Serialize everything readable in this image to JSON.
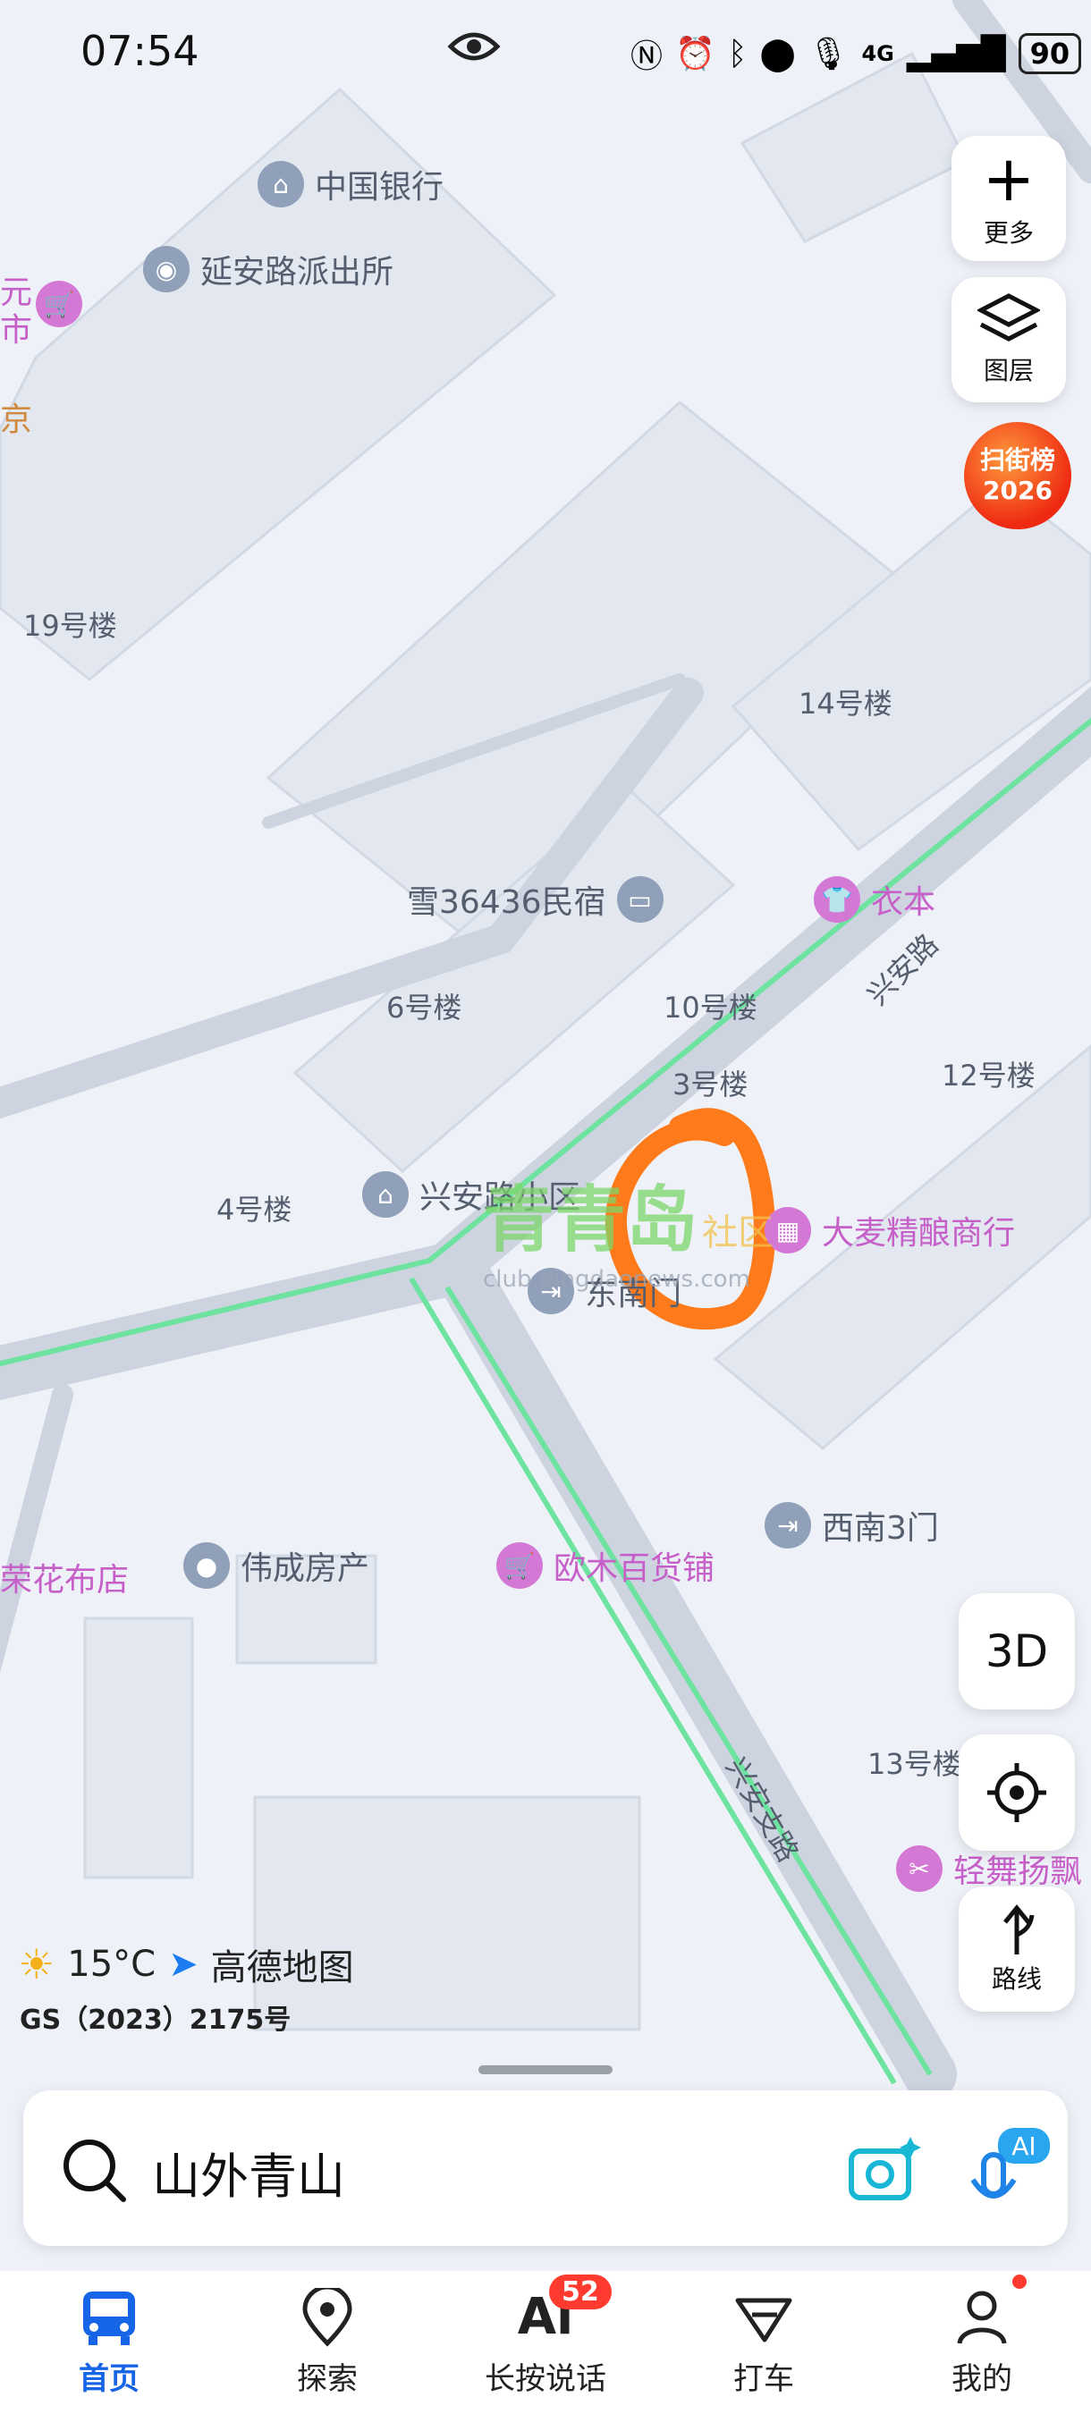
{
  "status_bar": {
    "time": "07:54",
    "network": "4G",
    "battery": "90"
  },
  "side_buttons": {
    "more_label": "更多",
    "layers_label": "图层",
    "scan_line1": "扫街榜",
    "scan_line2": "2026",
    "mode_3d": "3D",
    "route_label": "路线"
  },
  "map": {
    "buildings": [
      "19号楼",
      "14号楼",
      "6号楼",
      "10号楼",
      "3号楼",
      "12号楼",
      "4号楼",
      "13号楼"
    ],
    "roads": [
      "兴安路",
      "兴安支路"
    ],
    "gates": [
      "东南门",
      "西南3门"
    ],
    "pois": [
      "中国银行",
      "延安路派出所",
      "雪36436民宿",
      "衣本",
      "兴安路小区",
      "大麦精酿商行",
      "伟成房产",
      "欧木百货铺",
      "轻舞扬飘",
      "荣花布店"
    ],
    "edge_fragments": [
      "元",
      "市",
      "京"
    ]
  },
  "watermark": {
    "text": "青青岛",
    "sub": "社区",
    "url": "club.qingdaonews.com"
  },
  "weather": {
    "temp": "15°C",
    "brand": "高德地图"
  },
  "license": "GS（2023）2175号",
  "search": {
    "query": "山外青山"
  },
  "tabbar": [
    {
      "label": "首页",
      "icon": "bus-icon",
      "active": true
    },
    {
      "label": "探索",
      "icon": "location-pin-icon"
    },
    {
      "label": "长按说话",
      "icon": "ai-voice-icon",
      "badge": "52"
    },
    {
      "label": "打车",
      "icon": "taxi-icon"
    },
    {
      "label": "我的",
      "icon": "user-icon"
    }
  ],
  "colors": {
    "accent": "#1565e6",
    "poi_pink": "#c65fc8",
    "road_green": "#6ee3a0",
    "circle_mark": "#ff7a1a"
  }
}
